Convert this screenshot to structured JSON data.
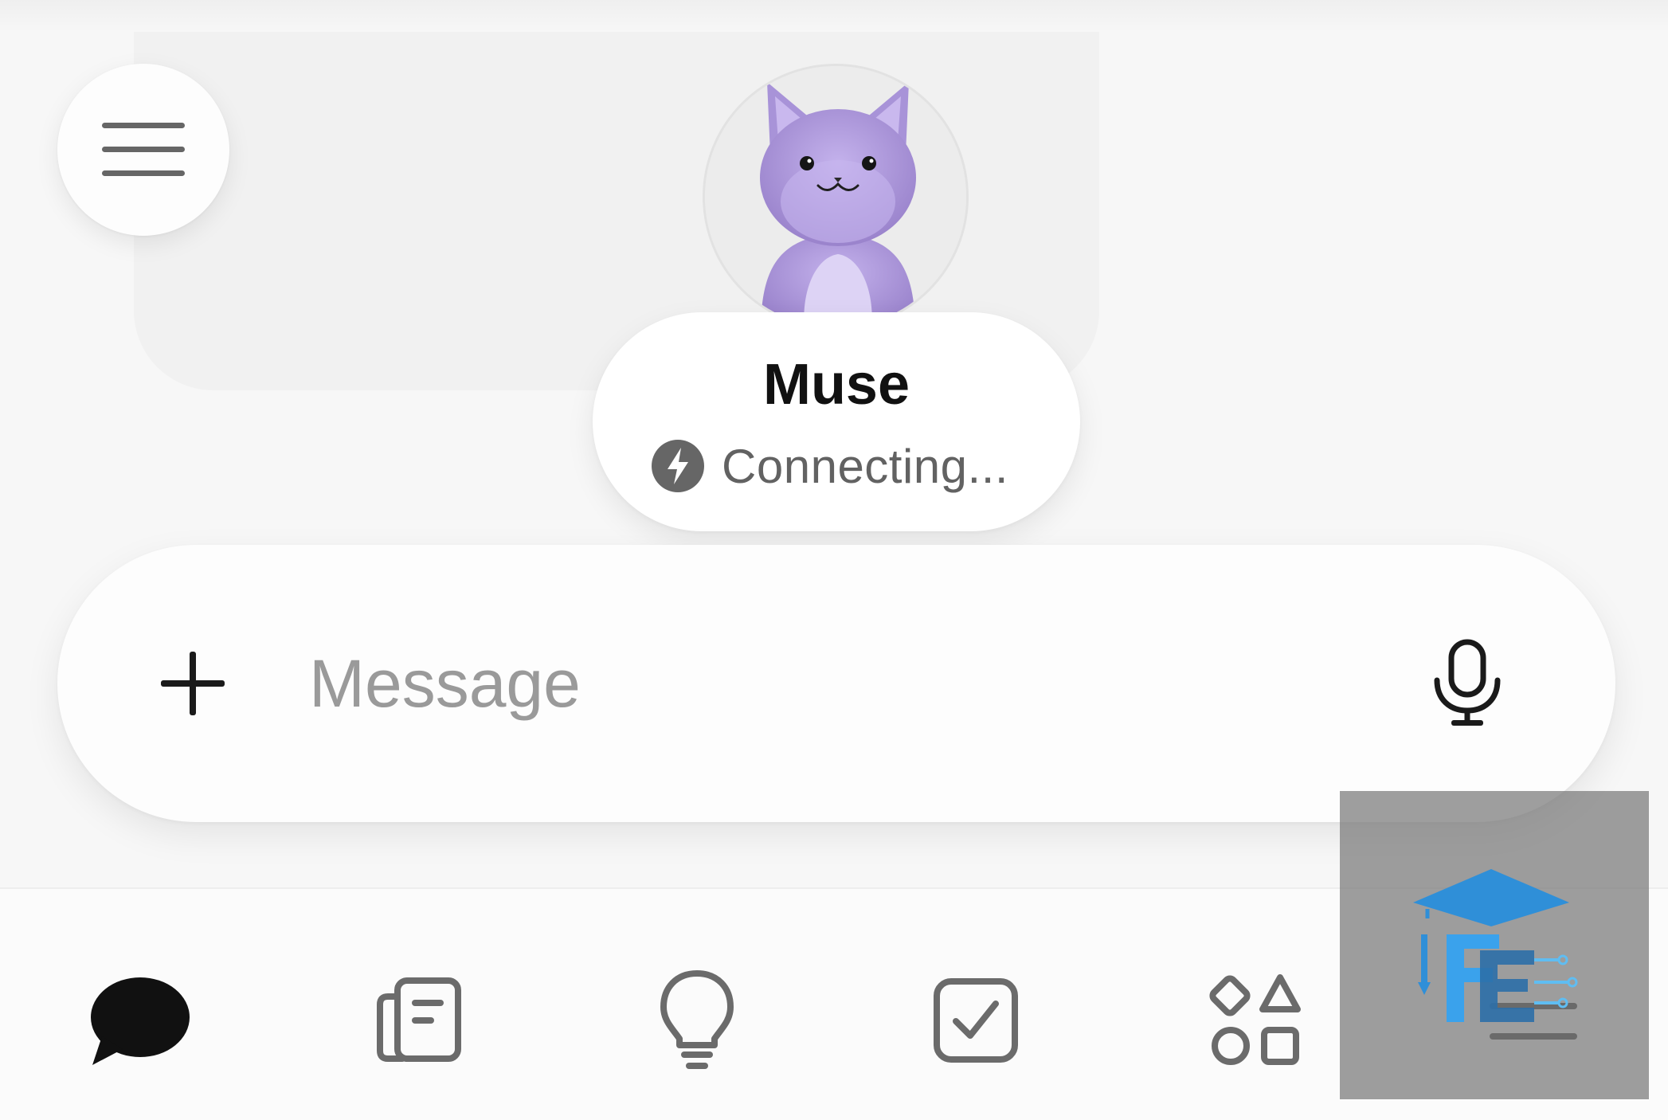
{
  "contact": {
    "name": "Muse",
    "status": "Connecting..."
  },
  "composer": {
    "placeholder": "Message"
  },
  "tabbar": {
    "items": [
      {
        "icon": "chat-bubble-icon",
        "active": true
      },
      {
        "icon": "notes-icon",
        "active": false
      },
      {
        "icon": "lightbulb-icon",
        "active": false
      },
      {
        "icon": "checkbox-icon",
        "active": false
      },
      {
        "icon": "shapes-icon",
        "active": false
      },
      {
        "icon": "menu-lines-icon",
        "active": false
      }
    ]
  },
  "colors": {
    "background": "#f7f7f7",
    "text_primary": "#111111",
    "text_secondary": "#626262",
    "placeholder": "#9a9a9a",
    "icon_gray": "#6b6b6b",
    "avatar_purple": "#a994d6",
    "watermark_blue": "#2f8fd8"
  }
}
